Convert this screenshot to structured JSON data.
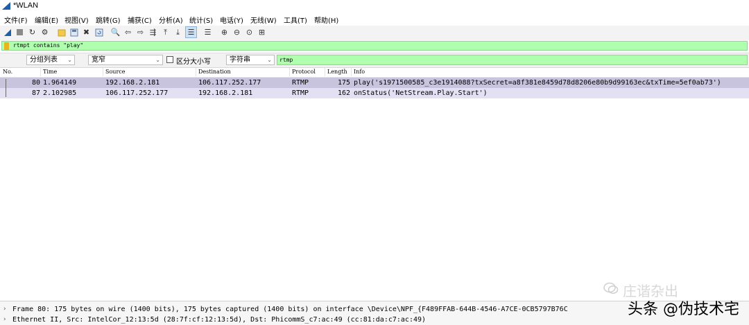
{
  "window": {
    "title": "*WLAN"
  },
  "menu": [
    "文件(F)",
    "编辑(E)",
    "视图(V)",
    "跳转(G)",
    "捕获(C)",
    "分析(A)",
    "统计(S)",
    "电话(Y)",
    "无线(W)",
    "工具(T)",
    "帮助(H)"
  ],
  "toolbar": {
    "icons": [
      "shark-fin-start-icon",
      "stop-icon",
      "restart-icon",
      "options-gear-icon",
      "open-folder-icon",
      "save-file-icon",
      "close-file-icon",
      "reload-icon",
      "find-icon",
      "back-arrow-icon",
      "forward-arrow-icon",
      "go-to-packet-icon",
      "first-packet-icon",
      "last-packet-icon",
      "autoscroll-icon",
      "colorize-icon",
      "zoom-in-icon",
      "zoom-out-icon",
      "normal-size-icon",
      "resize-columns-icon"
    ]
  },
  "display_filter": {
    "value": "rtmpt contains \"play\""
  },
  "search": {
    "scope": "分组列表",
    "char_width": "宽窄",
    "case_sensitive_label": "区分大小写",
    "search_type": "字符串",
    "query": "rtmp"
  },
  "packet_list": {
    "columns": [
      "No.",
      "Time",
      "Source",
      "Destination",
      "Protocol",
      "Length",
      "Info"
    ],
    "rows": [
      {
        "no": "80",
        "time": "1.964149",
        "source": "192.168.2.181",
        "destination": "106.117.252.177",
        "protocol": "RTMP",
        "length": "175",
        "info": "play('s1971500585_c3e1914088?txSecret=a8f381e8459d78d8206e80b9d99163ec&txTime=5ef0ab73')"
      },
      {
        "no": "87",
        "time": "2.102985",
        "source": "106.117.252.177",
        "destination": "192.168.2.181",
        "protocol": "RTMP",
        "length": "162",
        "info": "onStatus('NetStream.Play.Start')"
      }
    ]
  },
  "details": {
    "lines": [
      "Frame 80: 175 bytes on wire (1400 bits), 175 bytes captured (1400 bits) on interface \\Device\\NPF_{F489FFAB-644B-4546-A7CE-0CB5797B76C",
      "Ethernet II, Src: IntelCor_12:13:5d (28:7f:cf:12:13:5d), Dst: PhicommS_c7:ac:49 (cc:81:da:c7:ac:49)"
    ]
  },
  "watermark": {
    "faint": "庄谐杂出",
    "main": "头条 @伪技术宅"
  },
  "colors": {
    "filter_ok": "#afffaf",
    "row_selected": "#c9c4de",
    "row_rtmp": "#e4e0f4",
    "accent": "#3c6eb4"
  }
}
